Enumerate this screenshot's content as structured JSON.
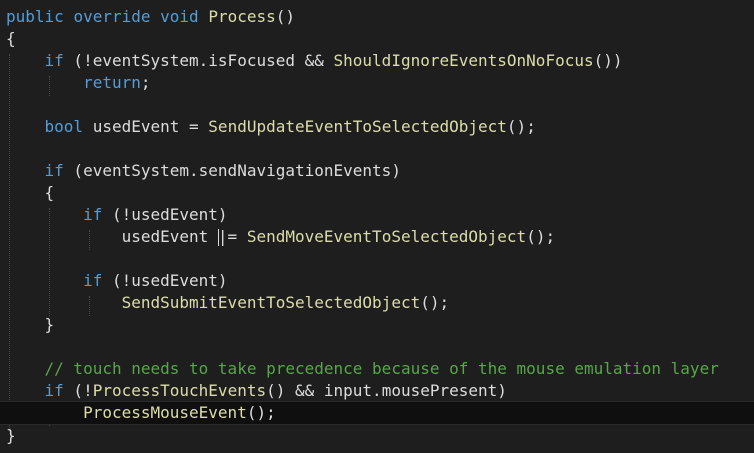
{
  "editor": {
    "colors": {
      "background": "#1e1e1e",
      "keyword": "#569cd6",
      "method": "#dcdcaa",
      "text": "#dcdcdc",
      "comment": "#57a64a"
    },
    "lines": {
      "l1": {
        "k1": "public",
        "s1": " ",
        "k2": "override",
        "s2": " ",
        "k3": "void",
        "s3": " ",
        "f1": "Process",
        "t1": "()"
      },
      "l2": {
        "t1": "{"
      },
      "l3": {
        "k1": "if",
        "t1": " (!eventSystem.isFocused && ",
        "f1": "ShouldIgnoreEventsOnNoFocus",
        "t2": "())"
      },
      "l4": {
        "k1": "return",
        "t1": ";"
      },
      "l5": {
        "k1": "bool",
        "t1": " usedEvent = ",
        "f1": "SendUpdateEventToSelectedObject",
        "t2": "();"
      },
      "l6": {
        "k1": "if",
        "t1": " (eventSystem.sendNavigationEvents)"
      },
      "l7": {
        "t1": "{"
      },
      "l8": {
        "k1": "if",
        "t1": " (!usedEvent)"
      },
      "l9": {
        "t1": "usedEvent ",
        "t2": "|= ",
        "f1": "SendMoveEventToSelectedObject",
        "t3": "();"
      },
      "l10": {
        "k1": "if",
        "t1": " (!usedEvent)"
      },
      "l11": {
        "f1": "SendSubmitEventToSelectedObject",
        "t1": "();"
      },
      "l12": {
        "t1": "}"
      },
      "l13": {
        "c1": "// touch needs to take precedence because of the mouse emulation layer"
      },
      "l14": {
        "k1": "if",
        "t1": " (!",
        "f1": "ProcessTouchEvents",
        "t2": "() && input.mousePresent)"
      },
      "l15": {
        "f1": "ProcessMouseEvent",
        "t1": "();"
      },
      "l16": {
        "t1": "}"
      }
    }
  }
}
